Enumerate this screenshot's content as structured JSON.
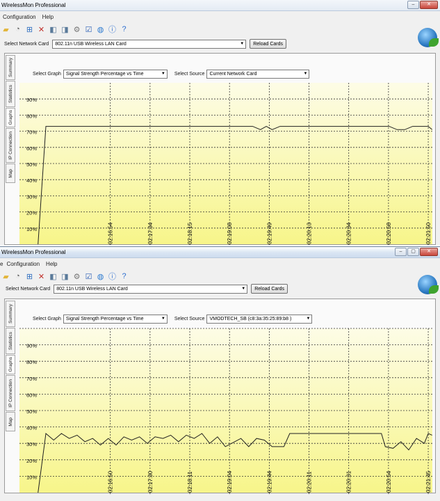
{
  "windows": [
    {
      "title": "WirelessMon Professional",
      "menu": [
        "Configuration",
        "Help"
      ],
      "network_card_label": "Select Network Card",
      "network_card_value": "802.11n USB Wireless LAN Card",
      "reload_label": "Reload Cards",
      "tabs": [
        "Summary",
        "Statistics",
        "Graphs",
        "IP Connection",
        "Map"
      ],
      "select_graph_label": "Select Graph",
      "select_graph_value": "Signal Strength Percentage vs Time",
      "select_source_label": "Select Source",
      "select_source_value": "Current Network Card"
    },
    {
      "title": "WirelessMon Professional",
      "menu": [
        "e",
        "Configuration",
        "Help"
      ],
      "network_card_label": "Select Network Card",
      "network_card_value": "802.11n USB Wireless LAN Card",
      "reload_label": "Reload Cards",
      "tabs": [
        "Summary",
        "Statistics",
        "Graphs",
        "IP Connection",
        "Map"
      ],
      "select_graph_label": "Select Graph",
      "select_graph_value": "Signal Strength Percentage vs Time",
      "select_source_label": "Select Source",
      "select_source_value": "VMODTECH_SB (c8:3a:35:25:89:b8 )"
    }
  ],
  "colors": {
    "plot_bg_top": "#fdfce6",
    "plot_bg_bottom": "#f7f58a",
    "series": "#202020"
  },
  "chart_data": [
    {
      "type": "line",
      "title": "",
      "xlabel": "",
      "ylabel": "",
      "ylim": [
        0,
        100
      ],
      "y_ticks": [
        "10%",
        "20%",
        "30%",
        "40%",
        "50%",
        "60%",
        "70%",
        "80%",
        "90%"
      ],
      "x_ticks": [
        "02:16:54",
        "02:17:34",
        "02:18:15",
        "02:19:08",
        "02:19:49",
        "02:20:13",
        "02:20:34",
        "02:20:58",
        "02:21:50"
      ],
      "grid": true,
      "series": [
        {
          "points": [
            [
              0.0,
              0
            ],
            [
              0.02,
              73
            ],
            [
              0.55,
              73
            ],
            [
              0.57,
              71
            ],
            [
              0.585,
              73
            ],
            [
              0.6,
              71
            ],
            [
              0.62,
              73
            ],
            [
              0.9,
              73
            ],
            [
              0.92,
              71
            ],
            [
              0.94,
              71
            ],
            [
              0.96,
              73
            ],
            [
              1.0,
              73
            ],
            [
              1.01,
              71
            ]
          ]
        }
      ]
    },
    {
      "type": "line",
      "title": "",
      "xlabel": "",
      "ylabel": "",
      "ylim": [
        0,
        100
      ],
      "y_ticks": [
        "10%",
        "20%",
        "30%",
        "40%",
        "50%",
        "60%",
        "70%",
        "80%",
        "90%",
        ""
      ],
      "x_ticks": [
        "02:16:50",
        "02:17:30",
        "02:18:11",
        "02:19:04",
        "02:19:44",
        "02:20:11",
        "02:20:31",
        "02:20:54",
        "02:21:45"
      ],
      "grid": true,
      "series": [
        {
          "points": [
            [
              0.0,
              0
            ],
            [
              0.02,
              36
            ],
            [
              0.04,
              32
            ],
            [
              0.06,
              36
            ],
            [
              0.08,
              33
            ],
            [
              0.1,
              35
            ],
            [
              0.12,
              31
            ],
            [
              0.14,
              33
            ],
            [
              0.16,
              29
            ],
            [
              0.18,
              33
            ],
            [
              0.2,
              29
            ],
            [
              0.22,
              34
            ],
            [
              0.24,
              32
            ],
            [
              0.26,
              34
            ],
            [
              0.28,
              30
            ],
            [
              0.3,
              34
            ],
            [
              0.32,
              33
            ],
            [
              0.34,
              35
            ],
            [
              0.36,
              31
            ],
            [
              0.38,
              35
            ],
            [
              0.4,
              33
            ],
            [
              0.42,
              36
            ],
            [
              0.44,
              30
            ],
            [
              0.46,
              34
            ],
            [
              0.48,
              28
            ],
            [
              0.52,
              33
            ],
            [
              0.54,
              28
            ],
            [
              0.56,
              33
            ],
            [
              0.58,
              32
            ],
            [
              0.6,
              28
            ],
            [
              0.63,
              28
            ],
            [
              0.645,
              36
            ],
            [
              0.7,
              36
            ],
            [
              0.75,
              36
            ],
            [
              0.8,
              36
            ],
            [
              0.85,
              36
            ],
            [
              0.88,
              36
            ],
            [
              0.89,
              28
            ],
            [
              0.91,
              27
            ],
            [
              0.93,
              31
            ],
            [
              0.95,
              26
            ],
            [
              0.97,
              33
            ],
            [
              0.99,
              30
            ],
            [
              1.0,
              36
            ],
            [
              1.01,
              35
            ]
          ]
        }
      ]
    }
  ]
}
